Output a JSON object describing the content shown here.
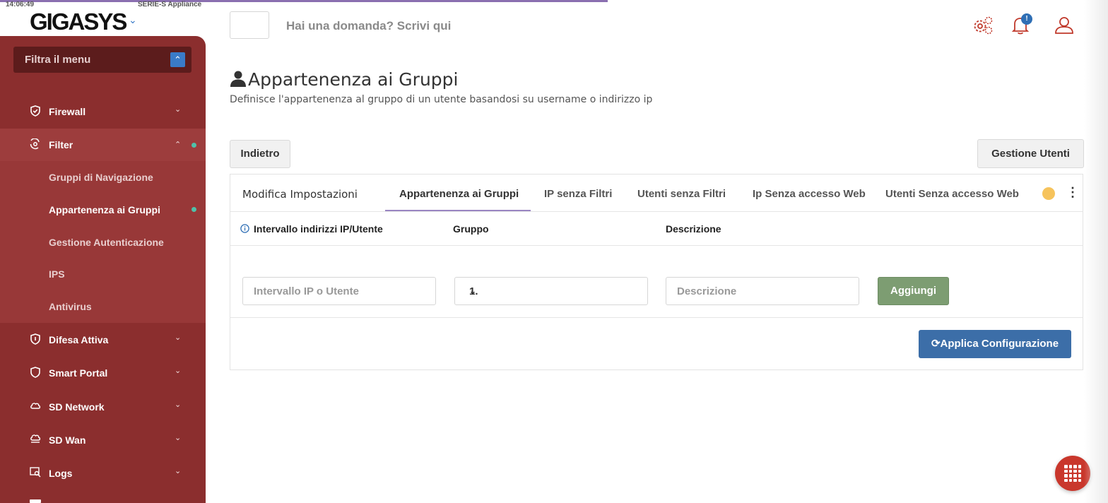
{
  "header": {
    "clock": "14:06:49",
    "series": "SERIE-S Appliance",
    "logo": "GIGASYS",
    "question_placeholder": "Hai una domanda? Scrivi qui",
    "notification_badge": "!"
  },
  "sidebar": {
    "filter_placeholder": "Filtra il menu",
    "items": [
      {
        "label": "Firewall",
        "icon": "shield-check-icon"
      },
      {
        "label": "Filter",
        "icon": "filter-icon"
      },
      {
        "label": "Difesa Attiva",
        "icon": "shield-icon"
      },
      {
        "label": "Smart Portal",
        "icon": "shield-icon"
      },
      {
        "label": "SD Network",
        "icon": "cloud-icon"
      },
      {
        "label": "SD Wan",
        "icon": "cloud-network-icon"
      },
      {
        "label": "Logs",
        "icon": "chart-search-icon"
      }
    ],
    "sub_items": [
      {
        "label": "Gruppi di Navigazione"
      },
      {
        "label": "Appartenenza ai Gruppi"
      },
      {
        "label": "Gestione Autenticazione"
      },
      {
        "label": "IPS"
      },
      {
        "label": "Antivirus"
      }
    ]
  },
  "page": {
    "title": "Appartenenza ai Gruppi",
    "subtitle": "Definisce l'appartenenza al gruppo di un utente basandosi su username o indirizzo ip",
    "back_label": "Indietro",
    "users_label": "Gestione Utenti"
  },
  "tabs": [
    {
      "label": "Modifica Impostazioni"
    },
    {
      "label": "Appartenenza ai Gruppi"
    },
    {
      "label": "IP senza Filtri"
    },
    {
      "label": "Utenti senza Filtri"
    },
    {
      "label": "Ip Senza accesso Web"
    },
    {
      "label": "Utenti Senza accesso Web"
    }
  ],
  "table": {
    "columns": [
      "Intervallo indirizzi IP/Utente",
      "Gruppo",
      "Descrizione"
    ],
    "ip_placeholder": "Intervallo IP o Utente",
    "group_value": "1.",
    "description_placeholder": "Descrizione",
    "add_label": "Aggiungi",
    "apply_label": "Applica Configurazione"
  },
  "colors": {
    "sidebar": "#8b2e2e",
    "accent_red": "#c0392b",
    "add_button": "#7d9d72",
    "apply_button": "#3c6ea8",
    "status_dot": "#f6c35c"
  }
}
